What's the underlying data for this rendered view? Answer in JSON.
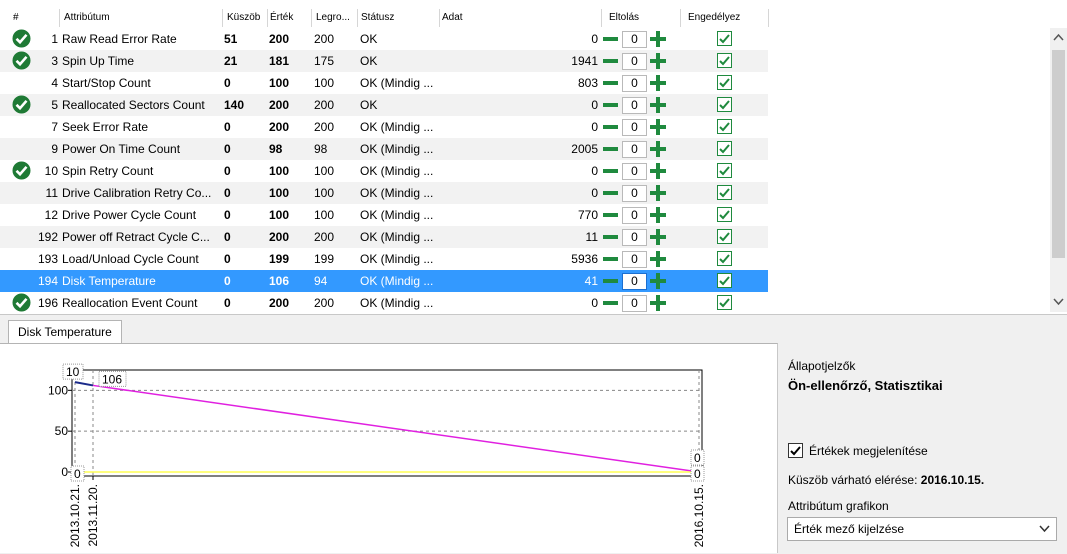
{
  "table": {
    "columns": {
      "num": "#",
      "attribute": "Attribútum",
      "threshold": "Küszöb",
      "value": "Érték",
      "worst": "Legro...",
      "status": "Státusz",
      "data": "Adat",
      "offset": "Eltolás",
      "enabled": "Engedélyez"
    },
    "rows": [
      {
        "id": "1",
        "name": "Raw Read Error Rate",
        "threshold": "51",
        "value": "200",
        "worst": "200",
        "status": "OK",
        "raw": "0",
        "offset": "0",
        "ok_icon": true
      },
      {
        "id": "3",
        "name": "Spin Up Time",
        "threshold": "21",
        "value": "181",
        "worst": "175",
        "status": "OK",
        "raw": "1941",
        "offset": "0",
        "ok_icon": true
      },
      {
        "id": "4",
        "name": "Start/Stop Count",
        "threshold": "0",
        "value": "100",
        "worst": "100",
        "status": "OK (Mindig ...",
        "raw": "803",
        "offset": "0",
        "ok_icon": false
      },
      {
        "id": "5",
        "name": "Reallocated Sectors Count",
        "threshold": "140",
        "value": "200",
        "worst": "200",
        "status": "OK",
        "raw": "0",
        "offset": "0",
        "ok_icon": true
      },
      {
        "id": "7",
        "name": "Seek Error Rate",
        "threshold": "0",
        "value": "200",
        "worst": "200",
        "status": "OK (Mindig ...",
        "raw": "0",
        "offset": "0",
        "ok_icon": false
      },
      {
        "id": "9",
        "name": "Power On Time Count",
        "threshold": "0",
        "value": "98",
        "worst": "98",
        "status": "OK (Mindig ...",
        "raw": "2005",
        "offset": "0",
        "ok_icon": false
      },
      {
        "id": "10",
        "name": "Spin Retry Count",
        "threshold": "0",
        "value": "100",
        "worst": "100",
        "status": "OK (Mindig ...",
        "raw": "0",
        "offset": "0",
        "ok_icon": true
      },
      {
        "id": "11",
        "name": "Drive Calibration Retry Co...",
        "threshold": "0",
        "value": "100",
        "worst": "100",
        "status": "OK (Mindig ...",
        "raw": "0",
        "offset": "0",
        "ok_icon": false
      },
      {
        "id": "12",
        "name": "Drive Power Cycle Count",
        "threshold": "0",
        "value": "100",
        "worst": "100",
        "status": "OK (Mindig ...",
        "raw": "770",
        "offset": "0",
        "ok_icon": false
      },
      {
        "id": "192",
        "name": "Power off Retract Cycle C...",
        "threshold": "0",
        "value": "200",
        "worst": "200",
        "status": "OK (Mindig ...",
        "raw": "11",
        "offset": "0",
        "ok_icon": false
      },
      {
        "id": "193",
        "name": "Load/Unload Cycle Count",
        "threshold": "0",
        "value": "199",
        "worst": "199",
        "status": "OK (Mindig ...",
        "raw": "5936",
        "offset": "0",
        "ok_icon": false
      },
      {
        "id": "194",
        "name": "Disk Temperature",
        "threshold": "0",
        "value": "106",
        "worst": "94",
        "status": "OK (Mindig ...",
        "raw": "41",
        "offset": "0",
        "ok_icon": false,
        "selected": true
      },
      {
        "id": "196",
        "name": "Reallocation Event Count",
        "threshold": "0",
        "value": "200",
        "worst": "200",
        "status": "OK (Mindig ...",
        "raw": "0",
        "offset": "0",
        "ok_icon": true
      }
    ]
  },
  "tab": {
    "label": "Disk Temperature"
  },
  "side": {
    "indicators_label": "Állapotjelzők",
    "indicators_value": "Ön-ellenőrző, Statisztikai",
    "show_values_label": "Értékek megjelenítése",
    "show_values_checked": true,
    "threshold_label": "Küszöb várható elérése:",
    "threshold_date": "2016.10.15.",
    "graph_label": "Attribútum grafikon",
    "graph_select": "Érték mező kijelzése"
  },
  "colors": {
    "selected_row": "#3399ff",
    "green": "#1f8a3e",
    "value_line": "#e020e0",
    "threshold_line": "#ffff55",
    "history_line": "#1a2a8a"
  },
  "chart_data": {
    "type": "line",
    "y_ticks": [
      "0",
      "50",
      "100"
    ],
    "ylim": [
      0,
      120
    ],
    "x_ticks": [
      "2013.10.21.",
      "2013.11.20.",
      "2016.10.15."
    ],
    "series": [
      {
        "points": [
          {
            "x": "2013.10.21.",
            "y": 110
          },
          {
            "x": "2013.11.20.",
            "y": 106
          }
        ]
      },
      {
        "points": [
          {
            "x": "2013.11.20.",
            "y": 106
          },
          {
            "x": "2016.10.15.",
            "y": 0
          }
        ]
      },
      {
        "points": [
          {
            "x": "2013.10.21.",
            "y": 0
          },
          {
            "x": "2016.10.15.",
            "y": 0
          }
        ]
      }
    ],
    "data_labels": [
      {
        "text": "10",
        "x": "2013.10.21.",
        "y": 110
      },
      {
        "text": "106",
        "x": "2013.11.20.",
        "y": 106
      },
      {
        "text": "0",
        "x": "2013.10.21.",
        "y": 0
      },
      {
        "text": "0",
        "x": "2016.10.15.",
        "y": 0
      },
      {
        "text": "0",
        "x": "2016.10.15.",
        "y": 0
      }
    ]
  }
}
